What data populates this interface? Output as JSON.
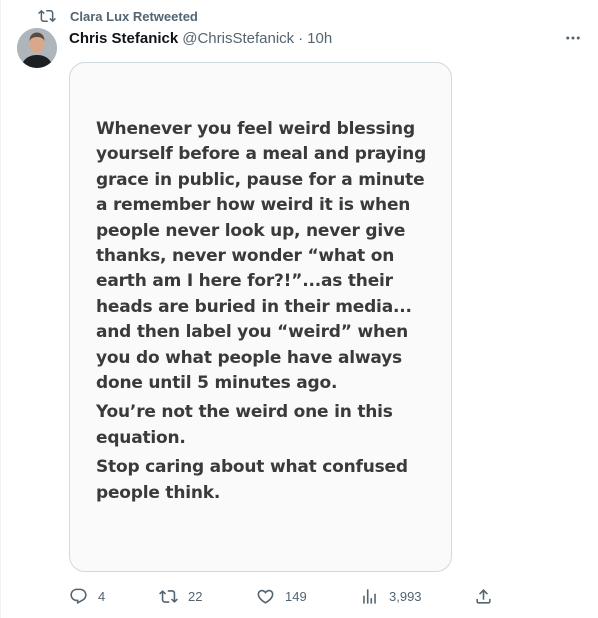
{
  "retweet_banner": {
    "text": "Clara Lux Retweeted",
    "icon": "retweet-icon"
  },
  "tweet": {
    "author_name": "Chris Stefanick",
    "author_handle": "@ChrisStefanick",
    "separator": "·",
    "time": "10h",
    "more_icon": "more-icon",
    "image_paragraphs": [
      "Whenever you feel weird blessing yourself before a meal and praying grace in public, pause for a minute a remember how weird it is when people never look up, never give thanks, never wonder “what on earth am I here for?!”...as their heads are buried in their media... and then label you “weird” when you do what people have always done until 5 minutes ago.",
      "You’re not the weird one in this equation.",
      "Stop caring about what confused people think."
    ]
  },
  "actions": {
    "replies": "4",
    "retweets": "22",
    "likes": "149",
    "views": "3,993"
  },
  "colors": {
    "text_primary": "#0f1419",
    "text_secondary": "#536471",
    "border": "#cfd9de"
  }
}
